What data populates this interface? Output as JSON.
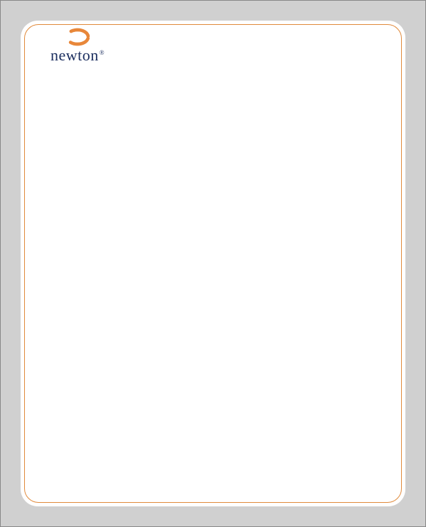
{
  "logo": {
    "brand_name": "newton",
    "registered_symbol": "®"
  },
  "colors": {
    "border_orange": "#e0893a",
    "logo_blue": "#1a2d5e",
    "logo_orange": "#e8873a",
    "background_gray": "#d0d0d0"
  }
}
